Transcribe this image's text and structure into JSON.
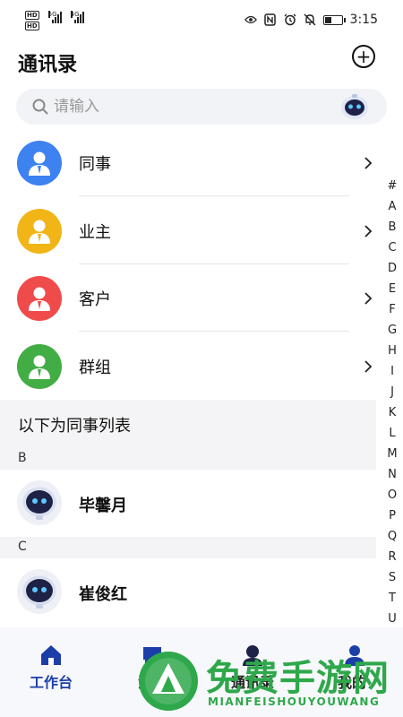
{
  "status_bar": {
    "hd1": "HD",
    "hd2": "HD",
    "net1": "5G",
    "net2": "4G",
    "time": "3:15",
    "icons": [
      "eye-icon",
      "nfc-icon",
      "alarm-icon",
      "mute-icon",
      "battery-icon"
    ],
    "battery_level": 0.4
  },
  "header": {
    "title": "通讯录",
    "add_icon": "plus-circle-icon"
  },
  "search": {
    "placeholder": "请输入",
    "icon": "search-icon",
    "assistant_icon": "robot-icon"
  },
  "categories": [
    {
      "label": "同事",
      "color": "#3d82f0",
      "icon": "person-icon"
    },
    {
      "label": "业主",
      "color": "#f2b517",
      "icon": "person-icon"
    },
    {
      "label": "客户",
      "color": "#f04b4b",
      "icon": "person-icon"
    },
    {
      "label": "群组",
      "color": "#43ad45",
      "icon": "person-icon"
    }
  ],
  "contacts_section": {
    "title": "以下为同事列表",
    "groups": [
      {
        "letter": "B",
        "contacts": [
          {
            "name": "毕馨月"
          }
        ]
      },
      {
        "letter": "C",
        "contacts": [
          {
            "name": "崔俊红"
          }
        ]
      }
    ]
  },
  "alphabet_index": [
    "#",
    "A",
    "B",
    "C",
    "D",
    "E",
    "F",
    "G",
    "H",
    "I",
    "J",
    "K",
    "L",
    "M",
    "N",
    "O",
    "P",
    "Q",
    "R",
    "S",
    "T",
    "U"
  ],
  "bottom_nav": {
    "items": [
      {
        "label": "工作台",
        "icon": "home-icon",
        "active": true
      },
      {
        "label": "消息",
        "icon": "message-icon",
        "active": false
      },
      {
        "label": "通讯录",
        "icon": "contacts-icon",
        "active": false
      },
      {
        "label": "我的",
        "icon": "profile-icon",
        "active": false
      }
    ]
  },
  "watermark": {
    "text": "免费手游网",
    "sub": "MIANFEISHOUYOUWANG"
  },
  "colors": {
    "accent": "#1c3ea8",
    "watermark": "#2ea84a"
  }
}
